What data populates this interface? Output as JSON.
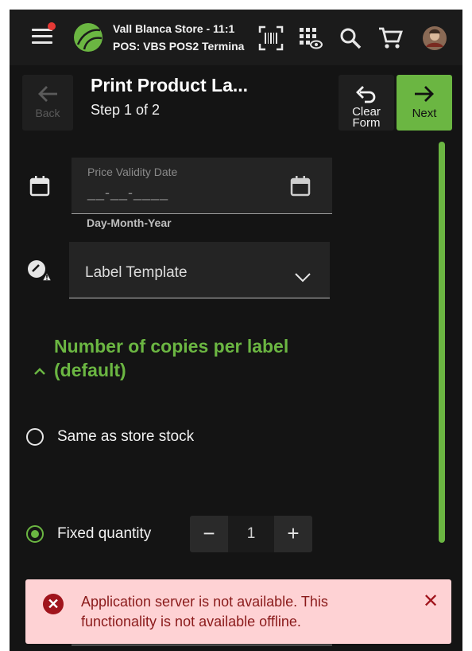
{
  "topbar": {
    "store_line": "Vall Blanca Store - 11:1",
    "pos_line": "POS: VBS POS2 Termina",
    "notification_color": "#e53935",
    "icons": [
      "menu-icon",
      "scan-barcode-icon",
      "grid-visibility-icon",
      "search-icon",
      "cart-icon",
      "avatar"
    ]
  },
  "header": {
    "back_label": "Back",
    "title": "Print Product La...",
    "step_text": "Step 1 of 2",
    "clear_label_1": "Clear",
    "clear_label_2": "Form",
    "next_label": "Next"
  },
  "form": {
    "date_field_label": "Price Validity Date",
    "date_mask": "__-__-____",
    "date_helper": "Day-Month-Year",
    "template_label": "Label Template",
    "section_title_line1": "Number of copies per label",
    "section_title_line2": "(default)",
    "option_same": "Same as store stock",
    "option_fixed": "Fixed quantity",
    "selected_option": "Fixed quantity",
    "stepper_minus": "−",
    "stepper_plus": "+",
    "stepper_value": "1"
  },
  "toast": {
    "message": "Application server is not available. This functionality is not available offline.",
    "close": "✕",
    "icon": "✕"
  },
  "colors": {
    "accent": "#6bb642",
    "background": "#141414",
    "error_bg": "#fed2d4",
    "error_text": "#8a1a1a"
  }
}
